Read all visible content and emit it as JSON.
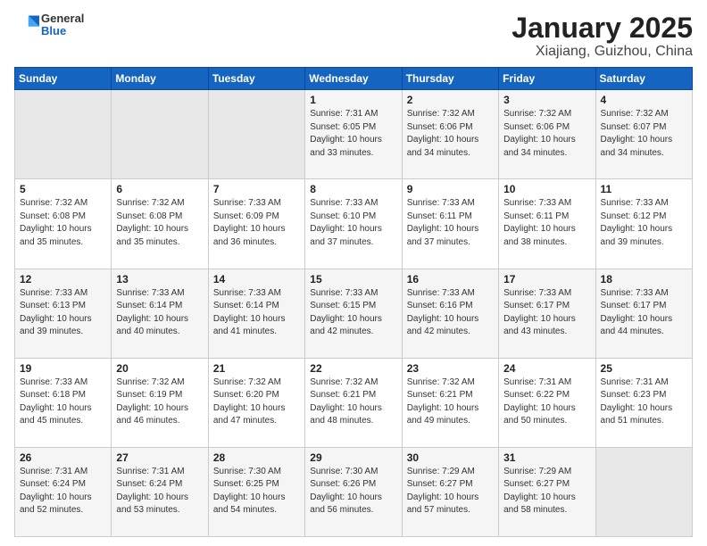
{
  "logo": {
    "general": "General",
    "blue": "Blue"
  },
  "title": "January 2025",
  "subtitle": "Xiajiang, Guizhou, China",
  "days_of_week": [
    "Sunday",
    "Monday",
    "Tuesday",
    "Wednesday",
    "Thursday",
    "Friday",
    "Saturday"
  ],
  "weeks": [
    [
      {
        "day": "",
        "info": ""
      },
      {
        "day": "",
        "info": ""
      },
      {
        "day": "",
        "info": ""
      },
      {
        "day": "1",
        "info": "Sunrise: 7:31 AM\nSunset: 6:05 PM\nDaylight: 10 hours\nand 33 minutes."
      },
      {
        "day": "2",
        "info": "Sunrise: 7:32 AM\nSunset: 6:06 PM\nDaylight: 10 hours\nand 34 minutes."
      },
      {
        "day": "3",
        "info": "Sunrise: 7:32 AM\nSunset: 6:06 PM\nDaylight: 10 hours\nand 34 minutes."
      },
      {
        "day": "4",
        "info": "Sunrise: 7:32 AM\nSunset: 6:07 PM\nDaylight: 10 hours\nand 34 minutes."
      }
    ],
    [
      {
        "day": "5",
        "info": "Sunrise: 7:32 AM\nSunset: 6:08 PM\nDaylight: 10 hours\nand 35 minutes."
      },
      {
        "day": "6",
        "info": "Sunrise: 7:32 AM\nSunset: 6:08 PM\nDaylight: 10 hours\nand 35 minutes."
      },
      {
        "day": "7",
        "info": "Sunrise: 7:33 AM\nSunset: 6:09 PM\nDaylight: 10 hours\nand 36 minutes."
      },
      {
        "day": "8",
        "info": "Sunrise: 7:33 AM\nSunset: 6:10 PM\nDaylight: 10 hours\nand 37 minutes."
      },
      {
        "day": "9",
        "info": "Sunrise: 7:33 AM\nSunset: 6:11 PM\nDaylight: 10 hours\nand 37 minutes."
      },
      {
        "day": "10",
        "info": "Sunrise: 7:33 AM\nSunset: 6:11 PM\nDaylight: 10 hours\nand 38 minutes."
      },
      {
        "day": "11",
        "info": "Sunrise: 7:33 AM\nSunset: 6:12 PM\nDaylight: 10 hours\nand 39 minutes."
      }
    ],
    [
      {
        "day": "12",
        "info": "Sunrise: 7:33 AM\nSunset: 6:13 PM\nDaylight: 10 hours\nand 39 minutes."
      },
      {
        "day": "13",
        "info": "Sunrise: 7:33 AM\nSunset: 6:14 PM\nDaylight: 10 hours\nand 40 minutes."
      },
      {
        "day": "14",
        "info": "Sunrise: 7:33 AM\nSunset: 6:14 PM\nDaylight: 10 hours\nand 41 minutes."
      },
      {
        "day": "15",
        "info": "Sunrise: 7:33 AM\nSunset: 6:15 PM\nDaylight: 10 hours\nand 42 minutes."
      },
      {
        "day": "16",
        "info": "Sunrise: 7:33 AM\nSunset: 6:16 PM\nDaylight: 10 hours\nand 42 minutes."
      },
      {
        "day": "17",
        "info": "Sunrise: 7:33 AM\nSunset: 6:17 PM\nDaylight: 10 hours\nand 43 minutes."
      },
      {
        "day": "18",
        "info": "Sunrise: 7:33 AM\nSunset: 6:17 PM\nDaylight: 10 hours\nand 44 minutes."
      }
    ],
    [
      {
        "day": "19",
        "info": "Sunrise: 7:33 AM\nSunset: 6:18 PM\nDaylight: 10 hours\nand 45 minutes."
      },
      {
        "day": "20",
        "info": "Sunrise: 7:32 AM\nSunset: 6:19 PM\nDaylight: 10 hours\nand 46 minutes."
      },
      {
        "day": "21",
        "info": "Sunrise: 7:32 AM\nSunset: 6:20 PM\nDaylight: 10 hours\nand 47 minutes."
      },
      {
        "day": "22",
        "info": "Sunrise: 7:32 AM\nSunset: 6:21 PM\nDaylight: 10 hours\nand 48 minutes."
      },
      {
        "day": "23",
        "info": "Sunrise: 7:32 AM\nSunset: 6:21 PM\nDaylight: 10 hours\nand 49 minutes."
      },
      {
        "day": "24",
        "info": "Sunrise: 7:31 AM\nSunset: 6:22 PM\nDaylight: 10 hours\nand 50 minutes."
      },
      {
        "day": "25",
        "info": "Sunrise: 7:31 AM\nSunset: 6:23 PM\nDaylight: 10 hours\nand 51 minutes."
      }
    ],
    [
      {
        "day": "26",
        "info": "Sunrise: 7:31 AM\nSunset: 6:24 PM\nDaylight: 10 hours\nand 52 minutes."
      },
      {
        "day": "27",
        "info": "Sunrise: 7:31 AM\nSunset: 6:24 PM\nDaylight: 10 hours\nand 53 minutes."
      },
      {
        "day": "28",
        "info": "Sunrise: 7:30 AM\nSunset: 6:25 PM\nDaylight: 10 hours\nand 54 minutes."
      },
      {
        "day": "29",
        "info": "Sunrise: 7:30 AM\nSunset: 6:26 PM\nDaylight: 10 hours\nand 56 minutes."
      },
      {
        "day": "30",
        "info": "Sunrise: 7:29 AM\nSunset: 6:27 PM\nDaylight: 10 hours\nand 57 minutes."
      },
      {
        "day": "31",
        "info": "Sunrise: 7:29 AM\nSunset: 6:27 PM\nDaylight: 10 hours\nand 58 minutes."
      },
      {
        "day": "",
        "info": ""
      }
    ]
  ]
}
